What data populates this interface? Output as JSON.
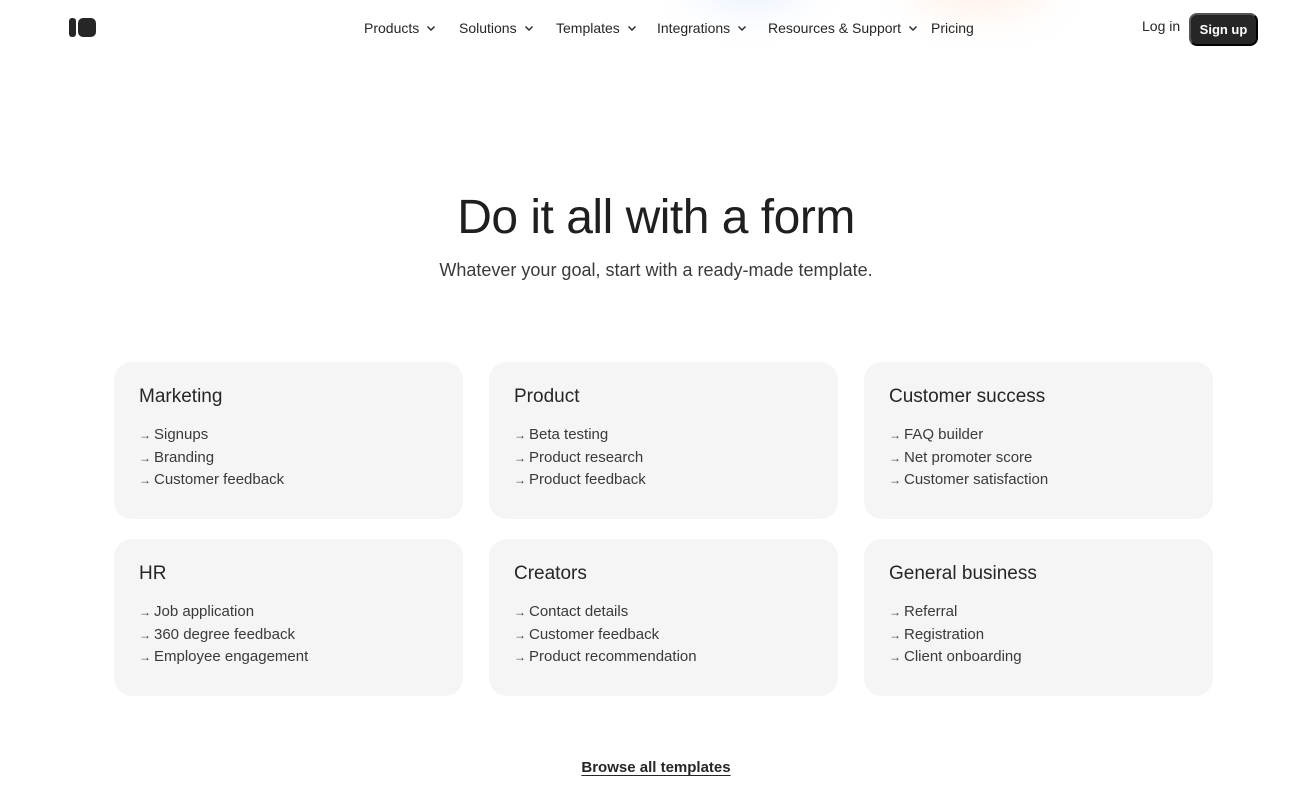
{
  "header": {
    "nav": [
      {
        "label": "Products",
        "has_dropdown": true
      },
      {
        "label": "Solutions",
        "has_dropdown": true
      },
      {
        "label": "Templates",
        "has_dropdown": true
      },
      {
        "label": "Integrations",
        "has_dropdown": true
      },
      {
        "label": "Resources & Support",
        "has_dropdown": true
      },
      {
        "label": "Pricing",
        "has_dropdown": false
      }
    ],
    "login_label": "Log in",
    "signup_label": "Sign up"
  },
  "hero": {
    "title": "Do it all with a form",
    "subtitle": "Whatever your goal, start with a ready-made template."
  },
  "cards": [
    {
      "title": "Marketing",
      "links": [
        "Signups",
        "Branding",
        "Customer feedback"
      ]
    },
    {
      "title": "Product",
      "links": [
        "Beta testing",
        "Product research",
        "Product feedback"
      ]
    },
    {
      "title": "Customer success",
      "links": [
        "FAQ builder",
        "Net promoter score",
        "Customer satisfaction"
      ]
    },
    {
      "title": "HR",
      "links": [
        "Job application",
        "360 degree feedback",
        "Employee engagement"
      ]
    },
    {
      "title": "Creators",
      "links": [
        "Contact details",
        "Customer feedback",
        "Product recommendation"
      ]
    },
    {
      "title": "General business",
      "links": [
        "Referral",
        "Registration",
        "Client onboarding"
      ]
    }
  ],
  "browse_label": "Browse all templates",
  "icons": {
    "link_arrow": "→",
    "dropdown": "chevron-down-icon",
    "logo": "typeform-logo-icon"
  },
  "colors": {
    "text": "#262627",
    "card_bg": "#f5f5f5",
    "button_bg": "#262627",
    "button_text": "#ffffff"
  }
}
